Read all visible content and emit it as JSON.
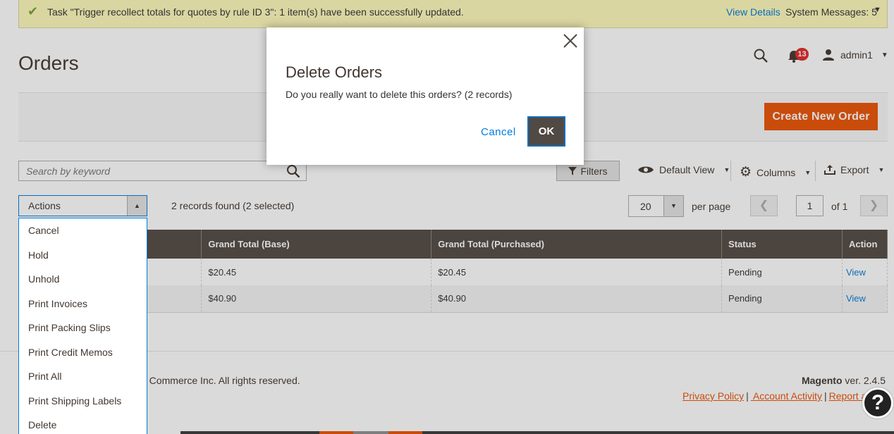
{
  "system_message": {
    "text": "Task \"Trigger recollect totals for quotes by rule ID 3\": 1 item(s) have been successfully updated.",
    "view_details": "View Details",
    "system_messages": "System Messages: 5"
  },
  "header": {
    "page_title": "Orders",
    "notifications_count": "13",
    "user_name": "admin1"
  },
  "page_actions": {
    "create_label": "Create New Order"
  },
  "toolbar": {
    "search_placeholder": "Search by keyword",
    "filters_label": "Filters",
    "view_label": "Default View",
    "columns_label": "Columns",
    "export_label": "Export"
  },
  "mass_actions": {
    "label": "Actions",
    "records_text": "2 records found (2 selected)",
    "items": [
      "Cancel",
      "Hold",
      "Unhold",
      "Print Invoices",
      "Print Packing Slips",
      "Print Credit Memos",
      "Print All",
      "Print Shipping Labels",
      "Delete"
    ]
  },
  "pager": {
    "per_page_value": "20",
    "per_page_label": "per page",
    "current_page": "1",
    "of_text": "of 1"
  },
  "grid": {
    "columns": [
      "Grand Total (Base)",
      "Grand Total (Purchased)",
      "Status",
      "Action"
    ],
    "rows": [
      {
        "base": "$20.45",
        "purchased": "$20.45",
        "status": "Pending",
        "action": "View"
      },
      {
        "base": "$40.90",
        "purchased": "$40.90",
        "status": "Pending",
        "action": "View"
      }
    ]
  },
  "footer": {
    "copyright": "o Commerce Inc. All rights reserved.",
    "brand": "Magento",
    "version": " ver. 2.4.5",
    "privacy": "Privacy Policy",
    "account_activity": " Account Activity",
    "report": "Report an"
  },
  "modal": {
    "title": "Delete Orders",
    "message": "Do you really want to delete this orders? (2 records)",
    "cancel_label": "Cancel",
    "ok_label": "OK"
  },
  "help": {
    "label": "?"
  },
  "colors": {
    "accent_orange": "#eb5202",
    "link_blue": "#007bdb",
    "header_dark": "#514943"
  }
}
